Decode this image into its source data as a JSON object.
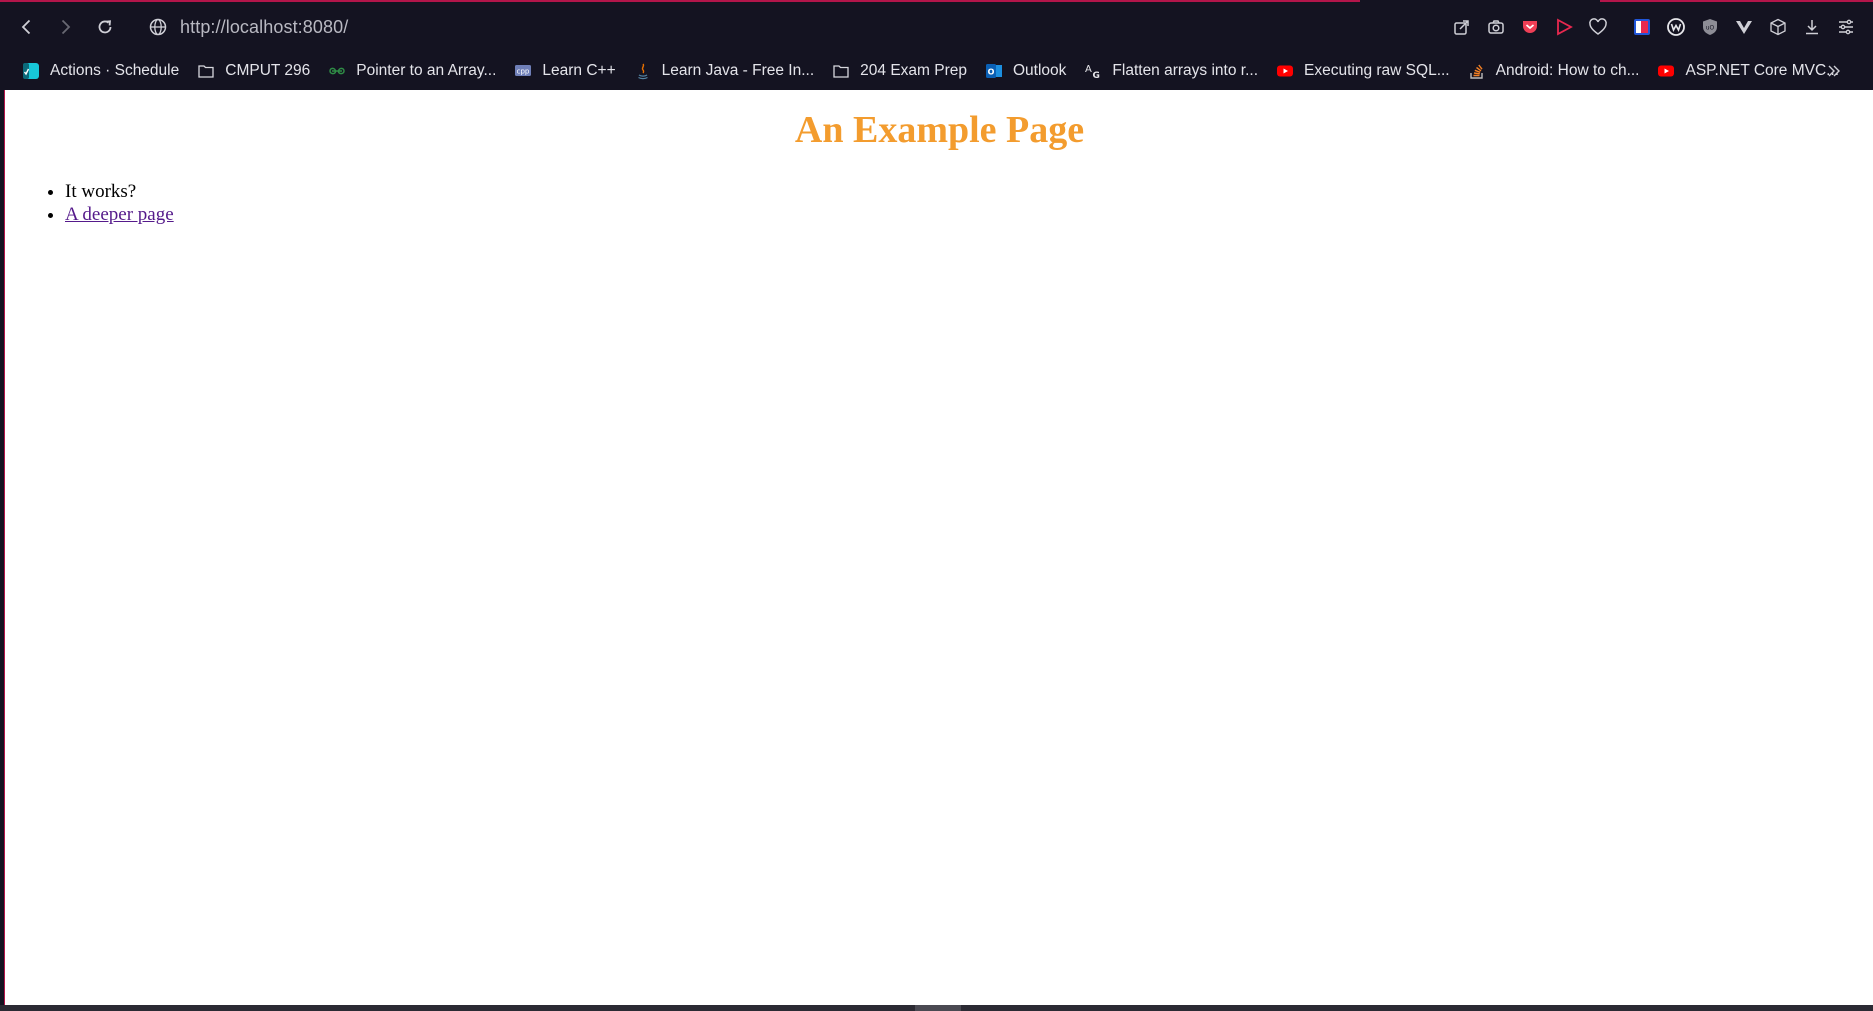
{
  "browser": {
    "url_host": "http://localhost",
    "url_rest": ":8080/",
    "accent_color": "#b3154a"
  },
  "toolbar": {
    "icons": [
      "share-icon",
      "camera-icon",
      "pocket-icon",
      "flow-icon",
      "heart-icon",
      "extension-1-icon",
      "extension-w-icon",
      "ublock-icon",
      "vue-devtools-icon",
      "box-icon",
      "download-icon",
      "menu-icon"
    ]
  },
  "bookmarks": {
    "items": [
      {
        "label": "Actions · Schedule",
        "icon": "app-icon"
      },
      {
        "label": "CMPUT 296",
        "icon": "folder-icon"
      },
      {
        "label": "Pointer to an Array...",
        "icon": "gfg-icon"
      },
      {
        "label": "Learn C++",
        "icon": "cpp-icon"
      },
      {
        "label": "Learn Java - Free In...",
        "icon": "java-icon"
      },
      {
        "label": "204 Exam Prep",
        "icon": "folder-icon"
      },
      {
        "label": "Outlook",
        "icon": "outlook-icon"
      },
      {
        "label": "Flatten arrays into r...",
        "icon": "ag-icon"
      },
      {
        "label": "Executing raw SQL...",
        "icon": "youtube-icon"
      },
      {
        "label": "Android: How to ch...",
        "icon": "stackoverflow-icon"
      },
      {
        "label": "ASP.NET Core MVC...",
        "icon": "youtube-icon"
      }
    ]
  },
  "page": {
    "title": "An Example Page",
    "items": [
      {
        "text": "It works?"
      },
      {
        "text": "A deeper page"
      }
    ],
    "title_color": "#f39c2e"
  }
}
